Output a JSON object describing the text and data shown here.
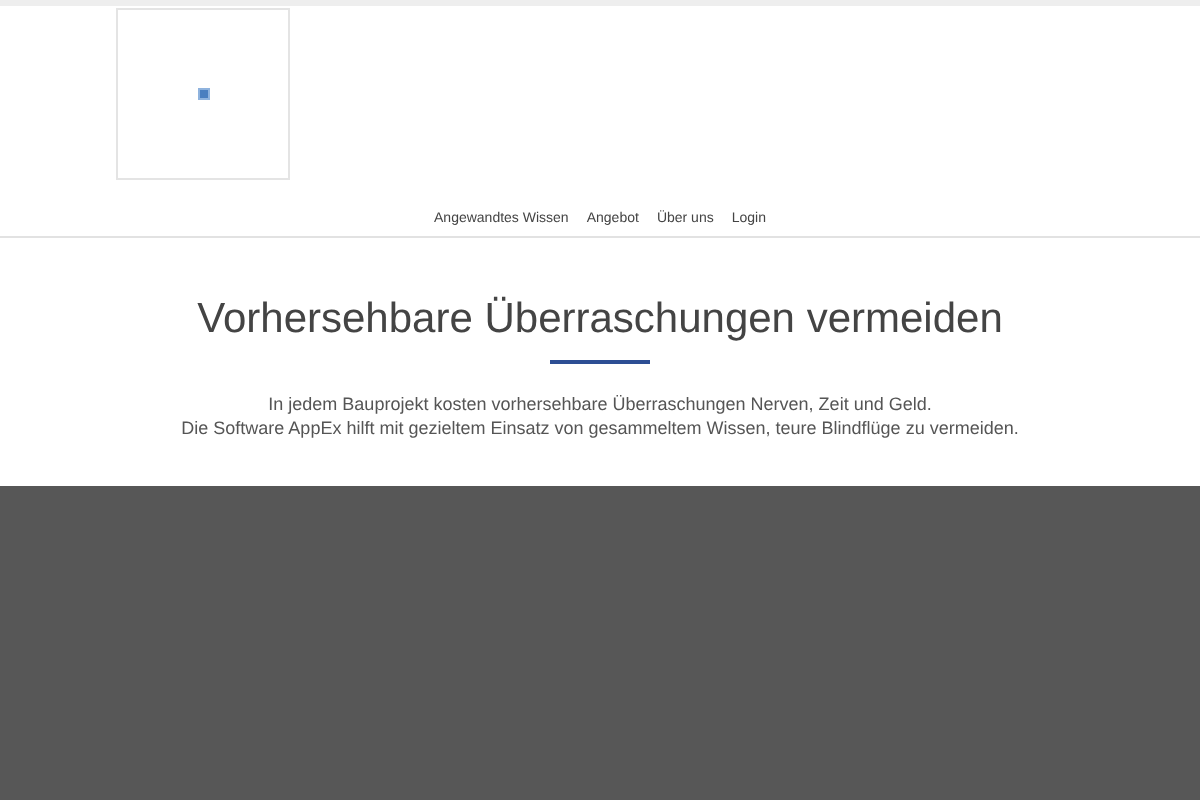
{
  "nav": {
    "items": [
      {
        "label": "Angewandtes Wissen"
      },
      {
        "label": "Angebot"
      },
      {
        "label": "Über uns"
      },
      {
        "label": "Login"
      }
    ]
  },
  "hero": {
    "heading": "Vorhersehbare Überraschungen vermeiden",
    "lines": [
      "In jedem Bauprojekt kosten vorhersehbare Überraschungen Nerven, Zeit und Geld.",
      "Die Software AppEx hilft mit gezieltem Einsatz von gesammeltem Wissen, teure Blindflüge zu vermeiden."
    ]
  }
}
